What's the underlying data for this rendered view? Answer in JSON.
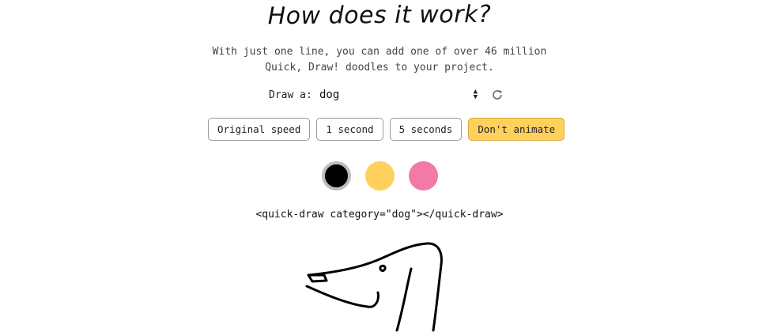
{
  "title": "How does it work?",
  "subtitle": {
    "line1": "With just one line, you can add one of over 46 million",
    "line2": "Quick, Draw! doodles to your project."
  },
  "draw": {
    "label": "Draw a:",
    "selected": "dog"
  },
  "buttons": [
    {
      "label": "Original speed",
      "active": false
    },
    {
      "label": "1 second",
      "active": false
    },
    {
      "label": "5 seconds",
      "active": false
    },
    {
      "label": "Don't animate",
      "active": true
    }
  ],
  "colors": [
    {
      "hex": "#000000",
      "selected": true
    },
    {
      "hex": "#ffd15c",
      "selected": false
    },
    {
      "hex": "#f27aa6",
      "selected": false
    }
  ],
  "code_snippet": "<quick-draw category=\"dog\"></quick-draw>",
  "icons": {
    "refresh": "refresh-icon",
    "select_arrows": "updown-arrows-icon"
  }
}
